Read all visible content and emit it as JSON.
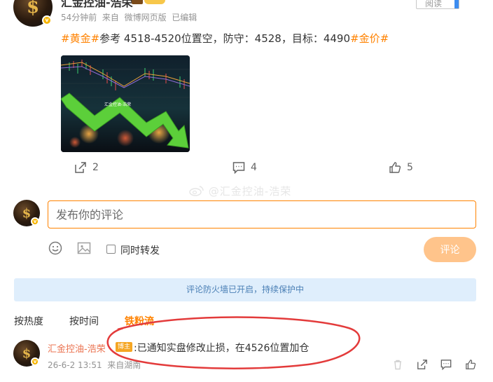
{
  "post": {
    "author": "汇金控油-浩荣",
    "read_label": "阅读",
    "time": "54分钟前",
    "source_prefix": "来自",
    "source": "微博网页版",
    "edited": "已编辑",
    "hashtag_gold": "#黄金#",
    "text": "参考 4518-4520位置空，防守：4528，目标：4490",
    "hashtag_price": "#金价#",
    "image_caption": "汇金控油-浩荣",
    "reposts": "2",
    "comments": "4",
    "likes": "5"
  },
  "watermark": "@汇金控油-浩荣",
  "composer": {
    "placeholder": "发布你的评论",
    "also_repost_label": "同时转发",
    "submit_label": "评论"
  },
  "notice": "评论防火墙已开启，持续保护中",
  "sort_tabs": [
    "按热度",
    "按时间",
    "铁粉流"
  ],
  "active_sort": 2,
  "comment": {
    "author": "汇金控油-浩荣",
    "badge": "博主",
    "text": "已通知实盘修改止损，在4526位置加仓",
    "date": "26-6-2 13:51",
    "location": "来自湖南"
  },
  "colors": {
    "accent": "#ff8200",
    "annotation": "#e33b3b",
    "notice_bg": "#dfeefc"
  }
}
